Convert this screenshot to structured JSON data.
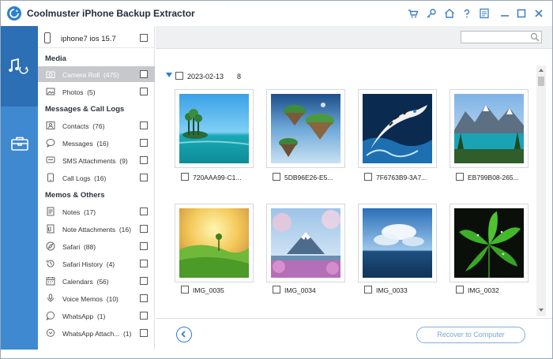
{
  "app": {
    "title": "Coolmuster iPhone Backup Extractor"
  },
  "titlebar": {
    "icons": [
      "cart-icon",
      "key-icon",
      "home-icon",
      "help-icon",
      "feedback-icon",
      "minimize-icon",
      "maximize-icon",
      "close-icon"
    ]
  },
  "rail": {
    "items": [
      "music-icon",
      "toolbox-icon"
    ]
  },
  "device": {
    "name": "iphone7 ios 15.7"
  },
  "sections": {
    "media": "Media",
    "messages": "Messages & Call Logs",
    "memos": "Memos & Others"
  },
  "categories": {
    "camera_roll": {
      "label": "Camera Roll",
      "count": "(475)"
    },
    "photos": {
      "label": "Photos",
      "count": "(5)"
    },
    "contacts": {
      "label": "Contacts",
      "count": "(76)"
    },
    "messages": {
      "label": "Messages",
      "count": "(16)"
    },
    "sms_attachments": {
      "label": "SMS Attachments",
      "count": "(9)"
    },
    "call_logs": {
      "label": "Call Logs",
      "count": "(16)"
    },
    "notes": {
      "label": "Notes",
      "count": "(17)"
    },
    "note_attachments": {
      "label": "Note Attachments",
      "count": "(16)"
    },
    "safari": {
      "label": "Safari",
      "count": "(88)"
    },
    "safari_history": {
      "label": "Safari History",
      "count": "(4)"
    },
    "calendars": {
      "label": "Calendars",
      "count": "(56)"
    },
    "voice_memos": {
      "label": "Voice Memos",
      "count": "(10)"
    },
    "whatsapp": {
      "label": "WhatsApp",
      "count": "(1)"
    },
    "whatsapp_attach": {
      "label": "WhatsApp Attach...",
      "count": "(1)"
    }
  },
  "search": {
    "placeholder": "",
    "value": ""
  },
  "group": {
    "date": "2023-02-13",
    "count": "8"
  },
  "photos": [
    {
      "name": "720AAA99-C1...",
      "theme": "tropical-lagoon"
    },
    {
      "name": "5DB96E26-E5...",
      "theme": "floating-islands"
    },
    {
      "name": "7F6763B9-3A7...",
      "theme": "white-tiger-water"
    },
    {
      "name": "EB799B08-265...",
      "theme": "mountain-lake"
    },
    {
      "name": "IMG_0035",
      "theme": "green-hills-sunset"
    },
    {
      "name": "IMG_0034",
      "theme": "mount-fuji-blossoms"
    },
    {
      "name": "IMG_0033",
      "theme": "sea-clouds"
    },
    {
      "name": "IMG_0032",
      "theme": "green-leaf"
    }
  ],
  "footer": {
    "recover_label": "Recover to Computer"
  },
  "colors": {
    "accent": "#2b7fd4",
    "rail": "#3f89d1",
    "rail_active": "#2c6fb4",
    "selected_row": "#c6c8cb"
  }
}
